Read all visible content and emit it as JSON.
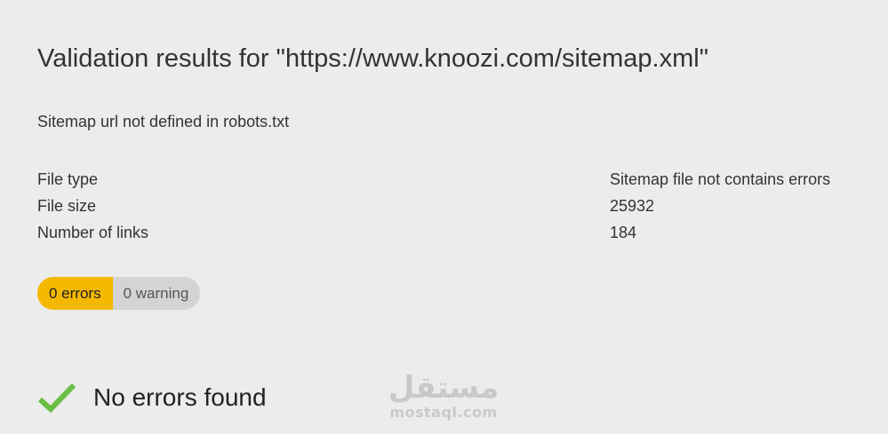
{
  "header": {
    "title": "Validation results for \"https://www.knoozi.com/sitemap.xml\""
  },
  "notice": {
    "text": "Sitemap url not defined in robots.txt"
  },
  "info": {
    "rows": [
      {
        "label": "File type",
        "value": "Sitemap file not contains errors"
      },
      {
        "label": "File size",
        "value": "25932"
      },
      {
        "label": "Number of links",
        "value": "184"
      }
    ]
  },
  "badges": {
    "errors_label": "0 errors",
    "warning_label": "0 warning",
    "errors_color": "#f5b800",
    "warning_color": "#d4d4d4"
  },
  "result": {
    "icon": "checkmark-icon",
    "icon_color": "#6abe45",
    "text": "No errors found"
  },
  "watermark": {
    "logo_text": "مستقل",
    "site": "mostaql.com"
  }
}
